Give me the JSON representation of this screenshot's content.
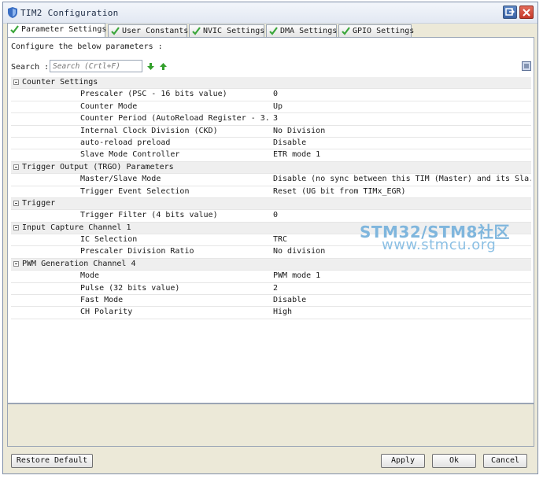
{
  "window": {
    "title": "TIM2 Configuration",
    "restore_icon": "restore-window-icon",
    "close_icon": "close-icon"
  },
  "tabs": [
    {
      "label": "Parameter Settings",
      "icon": "check-icon",
      "active": true
    },
    {
      "label": "User Constants",
      "icon": "check-icon",
      "active": false
    },
    {
      "label": "NVIC Settings",
      "icon": "check-icon",
      "active": false
    },
    {
      "label": "DMA Settings",
      "icon": "check-icon",
      "active": false
    },
    {
      "label": "GPIO Settings",
      "icon": "check-icon",
      "active": false
    }
  ],
  "panel": {
    "configure_text": "Configure the below parameters :",
    "search_label": "Search :",
    "search_placeholder": "Search (Crtl+F)"
  },
  "groups": [
    {
      "name": "Counter Settings",
      "params": [
        {
          "name": "Prescaler (PSC - 16 bits value)",
          "value": "0"
        },
        {
          "name": "Counter Mode",
          "value": "Up"
        },
        {
          "name": "Counter Period (AutoReload Register - 3...",
          "value": "3"
        },
        {
          "name": "Internal Clock Division (CKD)",
          "value": "No Division"
        },
        {
          "name": "auto-reload preload",
          "value": "Disable"
        },
        {
          "name": "Slave Mode Controller",
          "value": "ETR mode 1"
        }
      ]
    },
    {
      "name": "Trigger Output (TRGO) Parameters",
      "params": [
        {
          "name": "Master/Slave Mode",
          "value": "Disable (no sync between this TIM (Master) and its Sla..."
        },
        {
          "name": "Trigger Event Selection",
          "value": "Reset (UG bit from TIMx_EGR)"
        }
      ]
    },
    {
      "name": "Trigger",
      "params": [
        {
          "name": "Trigger Filter (4 bits value)",
          "value": "0"
        }
      ]
    },
    {
      "name": "Input Capture Channel 1",
      "params": [
        {
          "name": "IC Selection",
          "value": "TRC"
        },
        {
          "name": "Prescaler Division Ratio",
          "value": "No division"
        }
      ]
    },
    {
      "name": "PWM Generation Channel 4",
      "params": [
        {
          "name": "Mode",
          "value": "PWM mode 1"
        },
        {
          "name": "Pulse (32 bits value)",
          "value": "2"
        },
        {
          "name": "Fast Mode",
          "value": "Disable"
        },
        {
          "name": "CH Polarity",
          "value": "High"
        }
      ]
    }
  ],
  "watermark": {
    "line1": "STM32/STM8社区",
    "line2": "www.stmcu.org"
  },
  "buttons": {
    "restore_default": "Restore Default",
    "apply": "Apply",
    "ok": "Ok",
    "cancel": "Cancel"
  },
  "colors": {
    "check_green": "#3aa63a",
    "arrow_green": "#33a02c",
    "watermark_blue": "#7fb6dd"
  }
}
